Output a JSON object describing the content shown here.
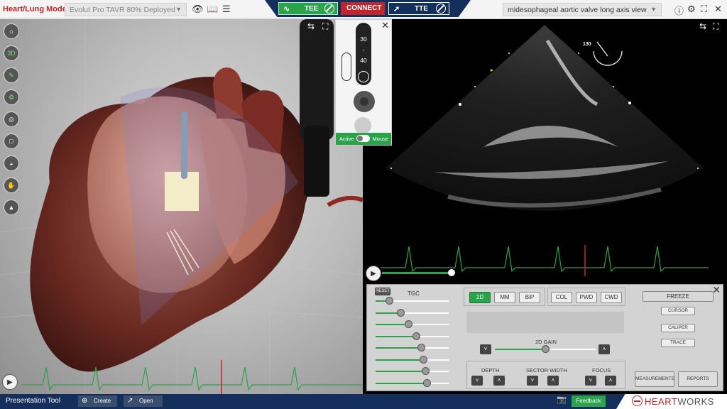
{
  "topbar": {
    "app_title": "Heart/Lung Model",
    "pathology_select": "Evolut Pro TAVR 80% Deployed",
    "view_select": "midesophageal aortic valve long axis view",
    "tee_label": "TEE",
    "connect_label": "CONNECT",
    "tte_label": "TTE"
  },
  "probe_panel": {
    "depth_ticks": [
      "30",
      "-",
      "40"
    ],
    "toggle_left": "Active",
    "toggle_right": "Mouse"
  },
  "echo": {
    "angle": "130"
  },
  "controls": {
    "reset": "RESET",
    "tgc": "TGC",
    "mode_2d": "2D",
    "mode_mm": "MM",
    "mode_bip": "BiP",
    "mode_col": "COL",
    "mode_pwd": "PWD",
    "mode_cwd": "CWD",
    "freeze": "FREEZE",
    "cursor": "CURSOR",
    "caliper": "CALIPER",
    "trace": "TRACE",
    "gain_2d": "2D GAIN",
    "depth": "DEPTH",
    "sector_width": "SECTOR WIDTH",
    "focus": "FOCUS",
    "measurements": "MEASUREMENTS",
    "reports": "REPORTS",
    "tgc_levels": [
      0.18,
      0.34,
      0.45,
      0.55,
      0.62,
      0.65,
      0.68,
      0.7
    ],
    "gain_level": 0.5
  },
  "bottombar": {
    "presentation_tool": "Presentation Tool",
    "create": "Create",
    "open": "Open",
    "feedback": "Feedback",
    "brand_heart": "HEART",
    "brand_works": "WORKS"
  },
  "colors": {
    "accent_green": "#2aa34a",
    "connect_red": "#c0262c",
    "navy": "#142f5c"
  }
}
